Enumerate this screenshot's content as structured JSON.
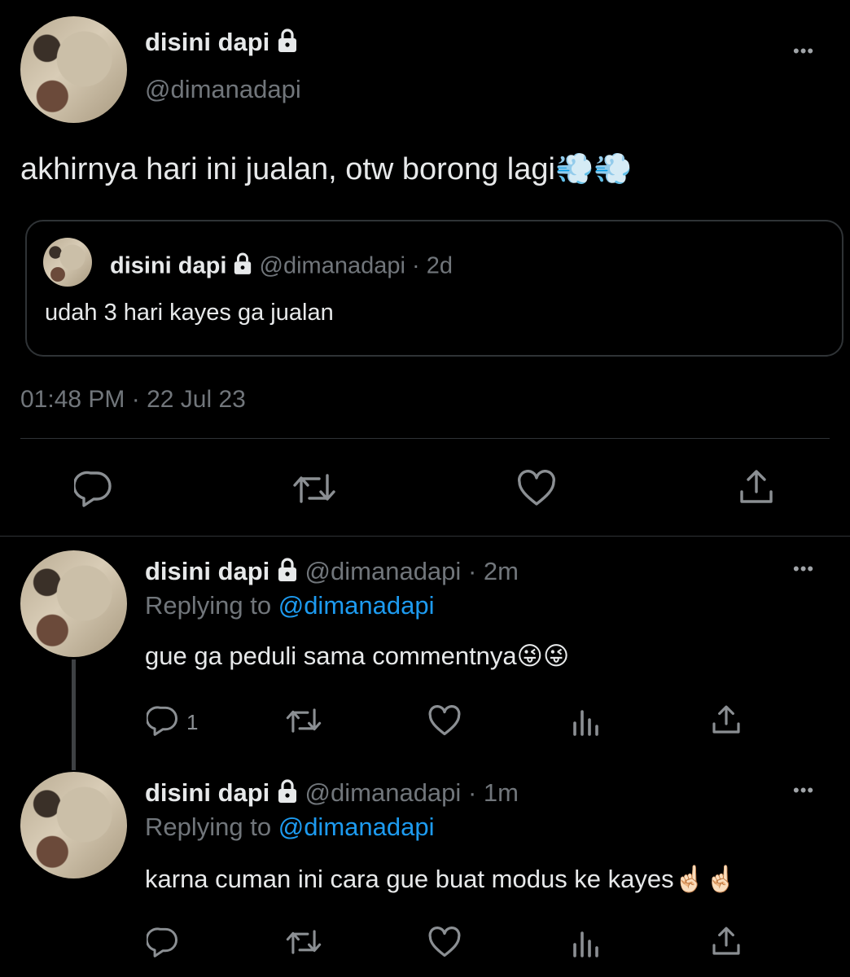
{
  "main_tweet": {
    "display_name": "disini dapi",
    "handle": "@dimanadapi",
    "text": "akhirnya hari ini jualan, otw borong lagi💨💨",
    "quoted": {
      "display_name": "disini dapi",
      "handle": "@dimanadapi",
      "time": "· 2d",
      "text": "udah 3 hari kayes ga jualan"
    },
    "timestamp": "01:48 PM · 22 Jul 23"
  },
  "replies": [
    {
      "display_name": "disini dapi",
      "handle": "@dimanadapi",
      "time": "· 2m",
      "replying_prefix": "Replying to",
      "replying_handle": "@dimanadapi",
      "text": "gue ga peduli sama commentnya😜😜",
      "reply_count": "1"
    },
    {
      "display_name": "disini dapi",
      "handle": "@dimanadapi",
      "time": "· 1m",
      "replying_prefix": "Replying to",
      "replying_handle": "@dimanadapi",
      "text": "karna cuman ini cara gue buat modus ke kayes☝🏻☝🏻",
      "reply_count": ""
    }
  ],
  "more_label": "•••",
  "icons": [
    "lock-icon",
    "reply-icon",
    "retweet-icon",
    "like-icon",
    "share-icon",
    "views-icon",
    "more-icon"
  ],
  "colors": {
    "background": "#000000",
    "text": "#e7e9ea",
    "muted": "#71767b",
    "link": "#1d9bf0",
    "border": "#2f3336"
  }
}
